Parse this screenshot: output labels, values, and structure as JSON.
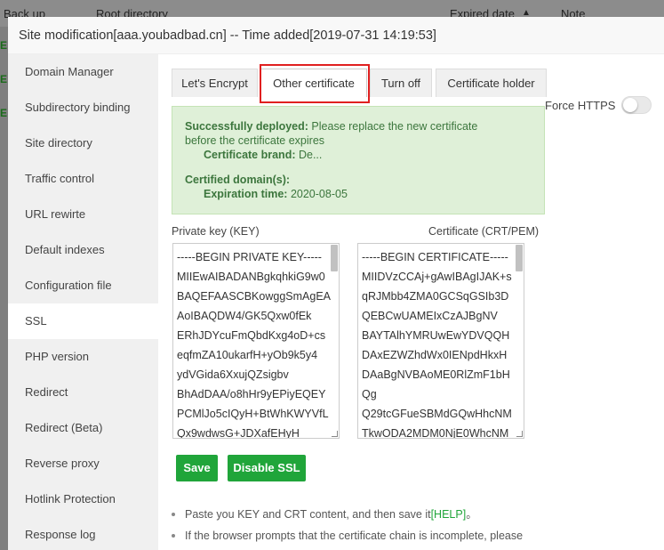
{
  "background": {
    "columns": [
      "Back up",
      "Root directory",
      "Expired date",
      "Note"
    ],
    "sort_arrow": "▲",
    "row_marks": [
      "E",
      "E",
      "E"
    ]
  },
  "modal": {
    "title": "Site modification[aaa.youbadbad.cn] -- Time added[2019-07-31 14:19:53]"
  },
  "sidebar": {
    "items": [
      {
        "label": "Domain Manager"
      },
      {
        "label": "Subdirectory binding"
      },
      {
        "label": "Site directory"
      },
      {
        "label": "Traffic control"
      },
      {
        "label": "URL rewirte"
      },
      {
        "label": "Default indexes"
      },
      {
        "label": "Configuration file"
      },
      {
        "label": "SSL"
      },
      {
        "label": "PHP version"
      },
      {
        "label": "Redirect"
      },
      {
        "label": "Redirect (Beta)"
      },
      {
        "label": "Reverse proxy"
      },
      {
        "label": "Hotlink Protection"
      },
      {
        "label": "Response log"
      }
    ],
    "active": "SSL"
  },
  "tabs": [
    {
      "label": "Let's Encrypt"
    },
    {
      "label": "Other certificate"
    },
    {
      "label": "Turn off"
    },
    {
      "label": "Certificate holder"
    }
  ],
  "active_tab": "Other certificate",
  "force_https": {
    "label": "Force HTTPS",
    "enabled": false
  },
  "status": {
    "deployed_label": "Successfully deployed:",
    "deployed_msg": "Please replace the new certificate",
    "deployed_msg2": "before the certificate expires",
    "brand_label": "Certificate brand:",
    "brand_value": "De...",
    "domains_label": "Certified domain(s):",
    "expiration_label": "Expiration time:",
    "expiration_value": "2020-08-05"
  },
  "private_key": {
    "label": "Private key (KEY)",
    "lines": [
      "-----BEGIN PRIVATE KEY-----",
      "MIIEwAIBADANBgkqhkiG9w0",
      "BAQEFAASCBKowggSmAgEA",
      "AoIBAQDW4/GK5Qxw0fEk",
      "ERhJDYcuFmQbdKxg4oD+cs",
      "eqfmZA10ukarfH+yOb9k5y4",
      "ydVGida6XxujQZsigbv",
      "BhAdDAA/o8hHr9yEPiyEQEY",
      "PCMlJo5cIQyH+BtWhKWYVfL",
      "Qx9wdwsG+JDXafEHyH"
    ]
  },
  "certificate": {
    "label": "Certificate (CRT/PEM)",
    "lines": [
      "-----BEGIN CERTIFICATE-----",
      "MIIDVzCCAj+gAwIBAgIJAK+s",
      "qRJMbb4ZMA0GCSqGSIb3D",
      "QEBCwUAMEIxCzAJBgNV",
      "BAYTAlhYMRUwEwYDVQQH",
      "DAxEZWZhdWx0IENpdHkxH",
      "DAaBgNVBAoME0RlZmF1bH",
      "Qg",
      "Q29tcGFueSBMdGQwHhcNM",
      "TkwODA2MDM0NjE0WhcNM"
    ]
  },
  "buttons": {
    "save": "Save",
    "disable": "Disable SSL"
  },
  "notes": {
    "note1_text": "Paste you KEY and CRT content, and then save it",
    "note1_link": "[HELP]",
    "note1_end": "。",
    "note2_text": "If the browser prompts that the certificate chain is incomplete, please"
  },
  "colors": {
    "accent": "#20a53a",
    "highlight": "#e02020",
    "success_bg": "#dff0d8"
  }
}
